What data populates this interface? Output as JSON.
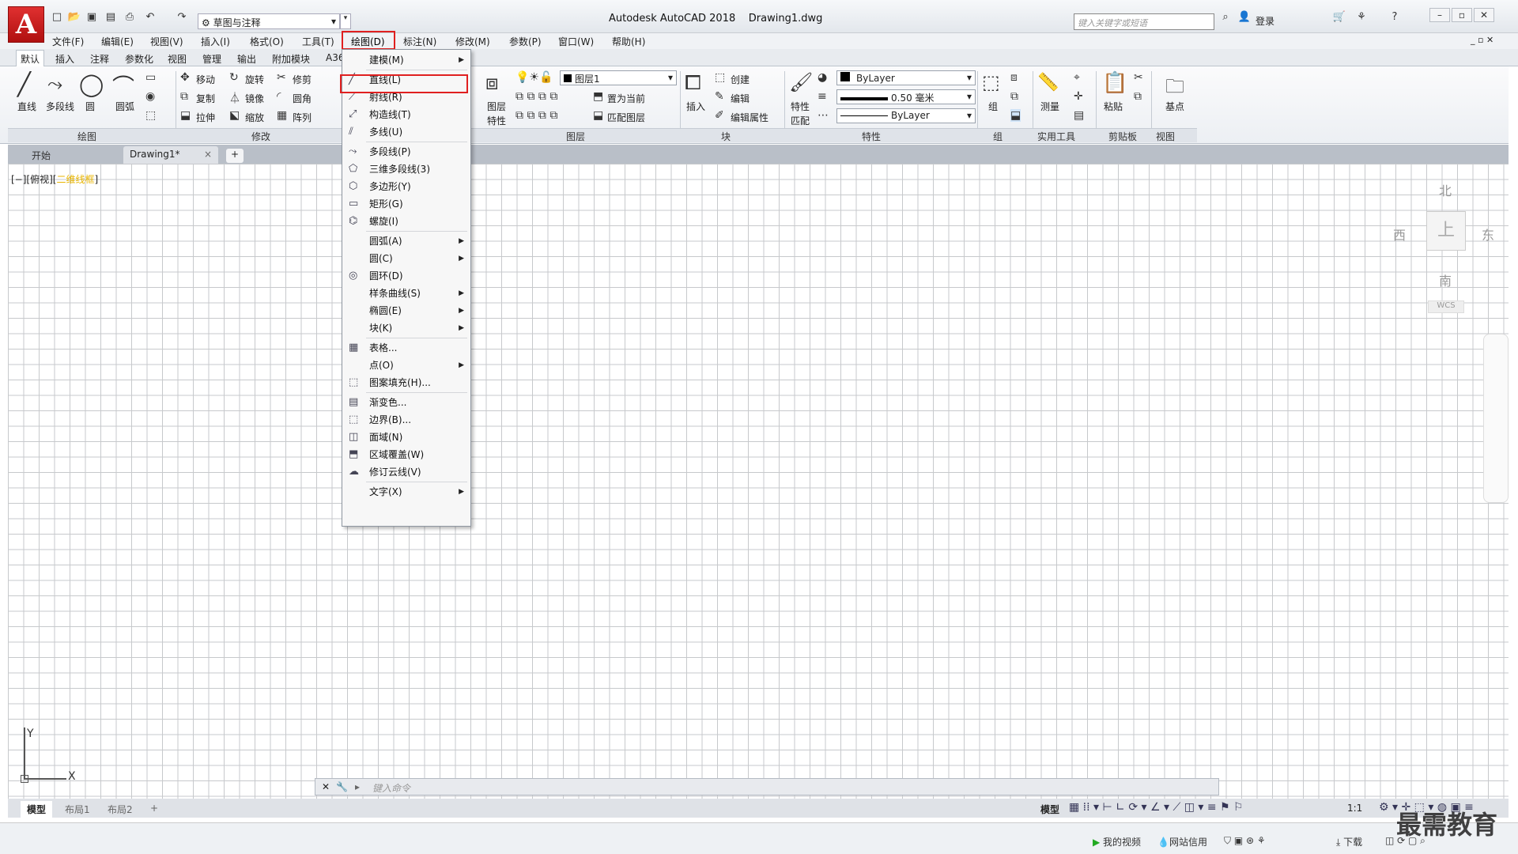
{
  "app": {
    "logo": "A",
    "title": "Autodesk AutoCAD 2018",
    "file": "Drawing1.dwg",
    "workspace": "草图与注释",
    "search_placeholder": "键入关键字或短语",
    "login": "登录"
  },
  "menubar": [
    "文件(F)",
    "编辑(E)",
    "视图(V)",
    "插入(I)",
    "格式(O)",
    "工具(T)",
    "绘图(D)",
    "标注(N)",
    "修改(M)",
    "参数(P)",
    "窗口(W)",
    "帮助(H)"
  ],
  "ribbon_tabs": [
    "默认",
    "插入",
    "注释",
    "参数化",
    "视图",
    "管理",
    "输出",
    "附加模块",
    "A36"
  ],
  "ribbon": {
    "draw": {
      "line": "直线",
      "polyline": "多段线",
      "circle": "圆",
      "arc": "圆弧",
      "group": "绘图"
    },
    "modify": {
      "move": "移动",
      "rotate": "旋转",
      "trim": "修剪",
      "copy": "复制",
      "mirror": "镜像",
      "fillet": "圆角",
      "stretch": "拉伸",
      "scale": "缩放",
      "array": "阵列",
      "group": "修改"
    },
    "layers": {
      "layer_props_1": "图层",
      "layer_props_2": "特性",
      "current_layer": "图层1",
      "set_current": "置为当前",
      "match_layer": "匹配图层",
      "group": "图层"
    },
    "block": {
      "insert": "插入",
      "create": "创建",
      "edit": "编辑",
      "edit_attr": "编辑属性",
      "group": "块"
    },
    "properties": {
      "match_1": "特性",
      "match_2": "匹配",
      "color": "ByLayer",
      "lineweight": "0.50 毫米",
      "linetype": "ByLayer",
      "group": "特性"
    },
    "groups": {
      "group": "组",
      "label": "组"
    },
    "utilities": {
      "measure": "测量",
      "group": "实用工具"
    },
    "clipboard": {
      "paste": "粘贴",
      "group": "剪贴板"
    },
    "view": {
      "base": "基点",
      "group": "视图"
    }
  },
  "file_tabs": [
    "开始",
    "Drawing1*"
  ],
  "view_label": {
    "prefix": "[−][俯视][",
    "style": "二维线框",
    "suffix": "]"
  },
  "viewcube": {
    "n": "北",
    "s": "南",
    "e": "东",
    "w": "西",
    "top": "上",
    "wcs": "WCS"
  },
  "ucs": {
    "x": "X",
    "y": "Y"
  },
  "command": {
    "placeholder": "键入命令"
  },
  "layout_tabs": [
    "模型",
    "布局1",
    "布局2"
  ],
  "status": {
    "model": "模型",
    "scale": "1:1"
  },
  "bottom": {
    "video": "我的视频",
    "net": "网站信用",
    "download": "下载"
  },
  "watermark": "最需教育",
  "dropdown": {
    "items": [
      {
        "label": "建模(M)",
        "icon": "",
        "sub": true
      },
      {
        "label": "直线(L)",
        "icon": "line-icon",
        "sub": false
      },
      {
        "label": "射线(R)",
        "icon": "ray-icon",
        "sub": false
      },
      {
        "label": "构造线(T)",
        "icon": "xline-icon",
        "sub": false
      },
      {
        "label": "多线(U)",
        "icon": "mline-icon",
        "sub": false
      },
      {
        "label": "多段线(P)",
        "icon": "polyline-icon",
        "sub": false
      },
      {
        "label": "三维多段线(3)",
        "icon": "3dpoly-icon",
        "sub": false
      },
      {
        "label": "多边形(Y)",
        "icon": "polygon-icon",
        "sub": false
      },
      {
        "label": "矩形(G)",
        "icon": "rectangle-icon",
        "sub": false
      },
      {
        "label": "螺旋(I)",
        "icon": "helix-icon",
        "sub": false
      },
      {
        "label": "圆弧(A)",
        "icon": "",
        "sub": true
      },
      {
        "label": "圆(C)",
        "icon": "",
        "sub": true
      },
      {
        "label": "圆环(D)",
        "icon": "donut-icon",
        "sub": false
      },
      {
        "label": "样条曲线(S)",
        "icon": "",
        "sub": true
      },
      {
        "label": "椭圆(E)",
        "icon": "",
        "sub": true
      },
      {
        "label": "块(K)",
        "icon": "",
        "sub": true
      },
      {
        "label": "表格...",
        "icon": "table-icon",
        "sub": false
      },
      {
        "label": "点(O)",
        "icon": "",
        "sub": true
      },
      {
        "label": "图案填充(H)...",
        "icon": "hatch-icon",
        "sub": false
      },
      {
        "label": "渐变色...",
        "icon": "gradient-icon",
        "sub": false
      },
      {
        "label": "边界(B)...",
        "icon": "boundary-icon",
        "sub": false
      },
      {
        "label": "面域(N)",
        "icon": "region-icon",
        "sub": false
      },
      {
        "label": "区域覆盖(W)",
        "icon": "wipeout-icon",
        "sub": false
      },
      {
        "label": "修订云线(V)",
        "icon": "revcloud-icon",
        "sub": false
      },
      {
        "label": "文字(X)",
        "icon": "",
        "sub": true
      }
    ]
  }
}
